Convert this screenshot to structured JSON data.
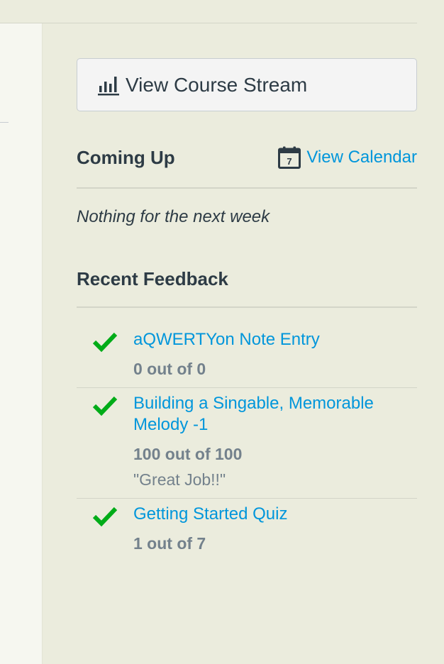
{
  "stream_button": {
    "label": "View Course Stream",
    "icon": "bar-chart-icon"
  },
  "coming_up": {
    "heading": "Coming Up",
    "calendar_link": "View Calendar",
    "calendar_icon_day": "7",
    "empty_text": "Nothing for the next week"
  },
  "feedback": {
    "heading": "Recent Feedback",
    "items": [
      {
        "title": "aQWERTYon Note Entry",
        "score": "0 out of 0"
      },
      {
        "title": "Building a Singable, Memorable Melody -1",
        "score": "100 out of 100",
        "comment": "\"Great Job!!\""
      },
      {
        "title": "Getting Started Quiz",
        "score": "1 out of 7"
      }
    ]
  },
  "colors": {
    "link": "#0096db",
    "check": "#00ac18",
    "sidebar_bg": "#ebecdd"
  }
}
